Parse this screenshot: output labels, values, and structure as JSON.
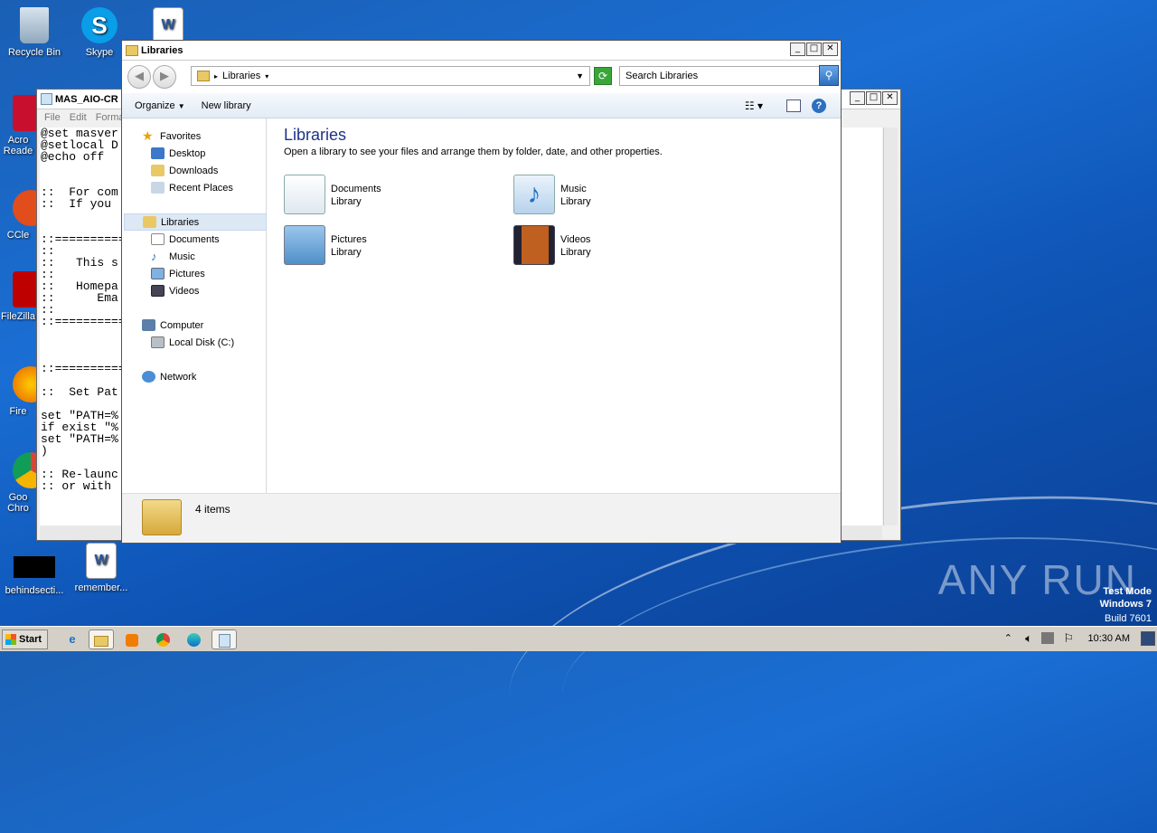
{
  "desktop": {
    "icons": [
      {
        "label": "Recycle Bin"
      },
      {
        "label": "Skype"
      },
      {
        "label": ""
      },
      {
        "label": "Acro Reade"
      },
      {
        "label": "CCle"
      },
      {
        "label": "FileZilla"
      },
      {
        "label": "Fire"
      },
      {
        "label": "Goo Chro"
      },
      {
        "label": "behindsecti..."
      },
      {
        "label": "remember..."
      }
    ],
    "watermark": {
      "brand": "ANY RUN",
      "line1": "Test Mode",
      "line2": "Windows 7",
      "line3": "Build 7601"
    }
  },
  "notepad": {
    "title": "MAS_AIO-CR",
    "menu": [
      "File",
      "Edit",
      "Forma"
    ],
    "lines": "@set masver\n@setlocal D\n@echo off\n\n\n::  For com\n::  If you\n\n\n::==========\n::\n::   This s\n::\n::   Homepa\n::      Ema\n::\n::==========\n\n\n\n::==========                                                                                       =====\n\n::  Set Pat\n\nset \"PATH=%\nif exist \"%\nset \"PATH=%                                                                                   TH%\"\n)\n\n:: Re-launc\n:: or with"
  },
  "explorer": {
    "title": "Libraries",
    "address": "Libraries",
    "search_placeholder": "Search Libraries",
    "toolbar": {
      "organize": "Organize",
      "new_library": "New library"
    },
    "nav": {
      "favorites": "Favorites",
      "desktop": "Desktop",
      "downloads": "Downloads",
      "recent": "Recent Places",
      "libraries": "Libraries",
      "documents": "Documents",
      "music": "Music",
      "pictures": "Pictures",
      "videos": "Videos",
      "computer": "Computer",
      "local_disk": "Local Disk (C:)",
      "network": "Network"
    },
    "content": {
      "title": "Libraries",
      "subtitle": "Open a library to see your files and arrange them by folder, date, and other properties.",
      "libs": [
        {
          "name": "Documents",
          "kind": "Library"
        },
        {
          "name": "Music",
          "kind": "Library"
        },
        {
          "name": "Pictures",
          "kind": "Library"
        },
        {
          "name": "Videos",
          "kind": "Library"
        }
      ]
    },
    "status": "4 items"
  },
  "taskbar": {
    "start": "Start",
    "time": "10:30 AM"
  }
}
